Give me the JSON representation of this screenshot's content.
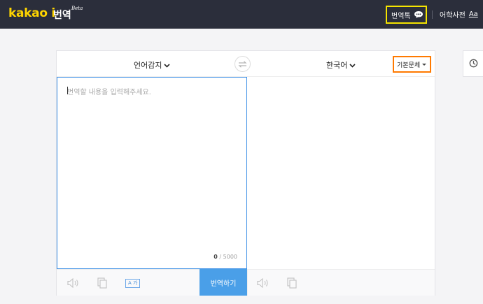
{
  "header": {
    "logo_text": "kakao i",
    "product_name": "번역",
    "beta_label": "Beta",
    "talk_label": "번역톡",
    "talk_icon": "chat-bubble-icon",
    "dict_label": "어학사전",
    "dict_icon_text": "Aa"
  },
  "lang_bar": {
    "source_lang": "언어감지",
    "target_lang": "한국어",
    "swap_icon": "swap-arrows-icon",
    "style_label": "기본문체"
  },
  "source": {
    "placeholder": "번역할 내용을 입력해주세요.",
    "value": "",
    "count_current": "0",
    "count_max": " / 5000"
  },
  "tools": {
    "listen_icon": "speaker-icon",
    "copy_icon": "copy-icon",
    "font_icon_text": "A 가",
    "translate_label": "번역하기"
  },
  "side": {
    "history_icon": "clock-icon"
  },
  "colors": {
    "header_bg": "#2b2e3b",
    "logo_yellow": "#ffd500",
    "accent_blue": "#4a9fe8",
    "highlight_yellow": "#f5e400",
    "highlight_orange": "#ff7a00"
  }
}
